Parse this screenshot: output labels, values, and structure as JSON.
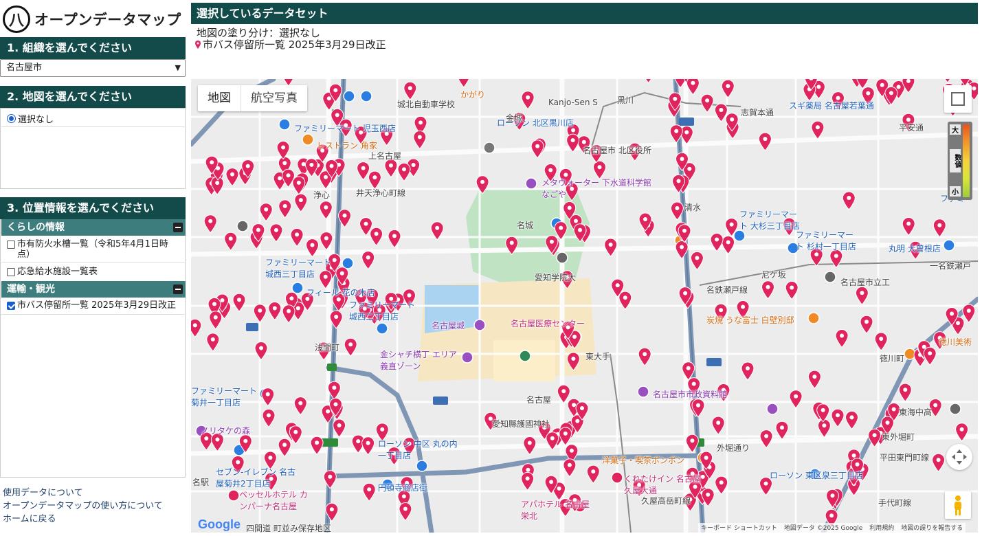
{
  "app": {
    "title": "オープンデータマップ",
    "logo_glyph": "八"
  },
  "sidebar": {
    "section1": {
      "title": "1. 組織を選んでください",
      "selected": "名古屋市"
    },
    "section2": {
      "title": "2. 地図を選んでください",
      "option": "選択なし"
    },
    "section3": {
      "title": "3. 位置情報を選んでください",
      "categories": [
        {
          "name": "くらしの情報",
          "items": [
            {
              "label": "市有防火水槽一覧（令和5年4月1日時点）",
              "checked": false
            },
            {
              "label": "応急給水施設一覧表",
              "checked": false
            }
          ]
        },
        {
          "name": "運輸・観光",
          "items": [
            {
              "label": "市バス停留所一覧 2025年3月29日改正",
              "checked": true
            }
          ]
        }
      ]
    },
    "links": [
      "使用データについて",
      "オープンデータマップの使い方について",
      "ホームに戻る"
    ]
  },
  "main": {
    "header": "選択しているデータセット",
    "choropleth": "地図の塗り分け：選択なし",
    "dataset": "市バス停留所一覧 2025年3月29日改正"
  },
  "map": {
    "tabs": [
      "地図",
      "航空写真"
    ],
    "legend": {
      "high": "大",
      "mid": "数値",
      "low": "小"
    },
    "attribution": [
      "キーボード ショートカット",
      "地図データ ©2025 Google",
      "利用規約",
      "地図の誤りを報告する"
    ],
    "google": "Google",
    "labels": [
      "城北自動車学校",
      "金城",
      "上名古屋",
      "名古屋市 北区役所",
      "黒川",
      "志賀本通",
      "平安通",
      "ファミリーマート 児玉西店",
      "ローソン 北区黒川店",
      "レストラン 角家",
      "メタウォーター 下水道科学館なごや",
      "名城",
      "清水",
      "ファミリーマート 大杉三丁目店",
      "ファミリーマート 杉村一丁目店",
      "丸明 大曽根店",
      "ファミリーマート 城西三丁目店",
      "愛知学院大",
      "尼ケ坂",
      "名古屋市立工",
      "フィール 花の木店",
      "ファミリーマート 城西二丁目店",
      "名古屋城",
      "名古屋医療センター",
      "炭焼 うな富士 白壁別邸",
      "徳川町",
      "浅間町",
      "東大手",
      "金シャチ横丁 エリア 義直ゾーン",
      "名古屋市市政資料館",
      "名古屋",
      "愛知縣護國神社",
      "ファミリーマート 菊井一丁目店",
      "東海中高",
      "円頓寺商店街",
      "ローソン 中区 丸の内一丁目店",
      "外堀通り",
      "セブン-イレブン 名古屋菊井2丁目店",
      "洋菓子・喫茶ボンボン",
      "くれたけイン 名古屋久屋大通",
      "ローソン 東区泉三丁目店",
      "ベッセルホテル カンパーナ名古屋",
      "アパホテル 名古屋栄北",
      "久屋高岳町線",
      "名駅",
      "四間道 町並み保存地区",
      "浄心",
      "井天浄心町線",
      "北区",
      "名鉄瀬戸線",
      "手代町線",
      "平田東門町線",
      "東外堀町",
      "徳川美術",
      "スギ薬局 名古屋若葉通",
      "ファミ",
      "一名鉄瀬戸",
      "かがり",
      "Kanjo-Sen S",
      "ノリタケの森",
      "栄",
      "泉"
    ]
  }
}
